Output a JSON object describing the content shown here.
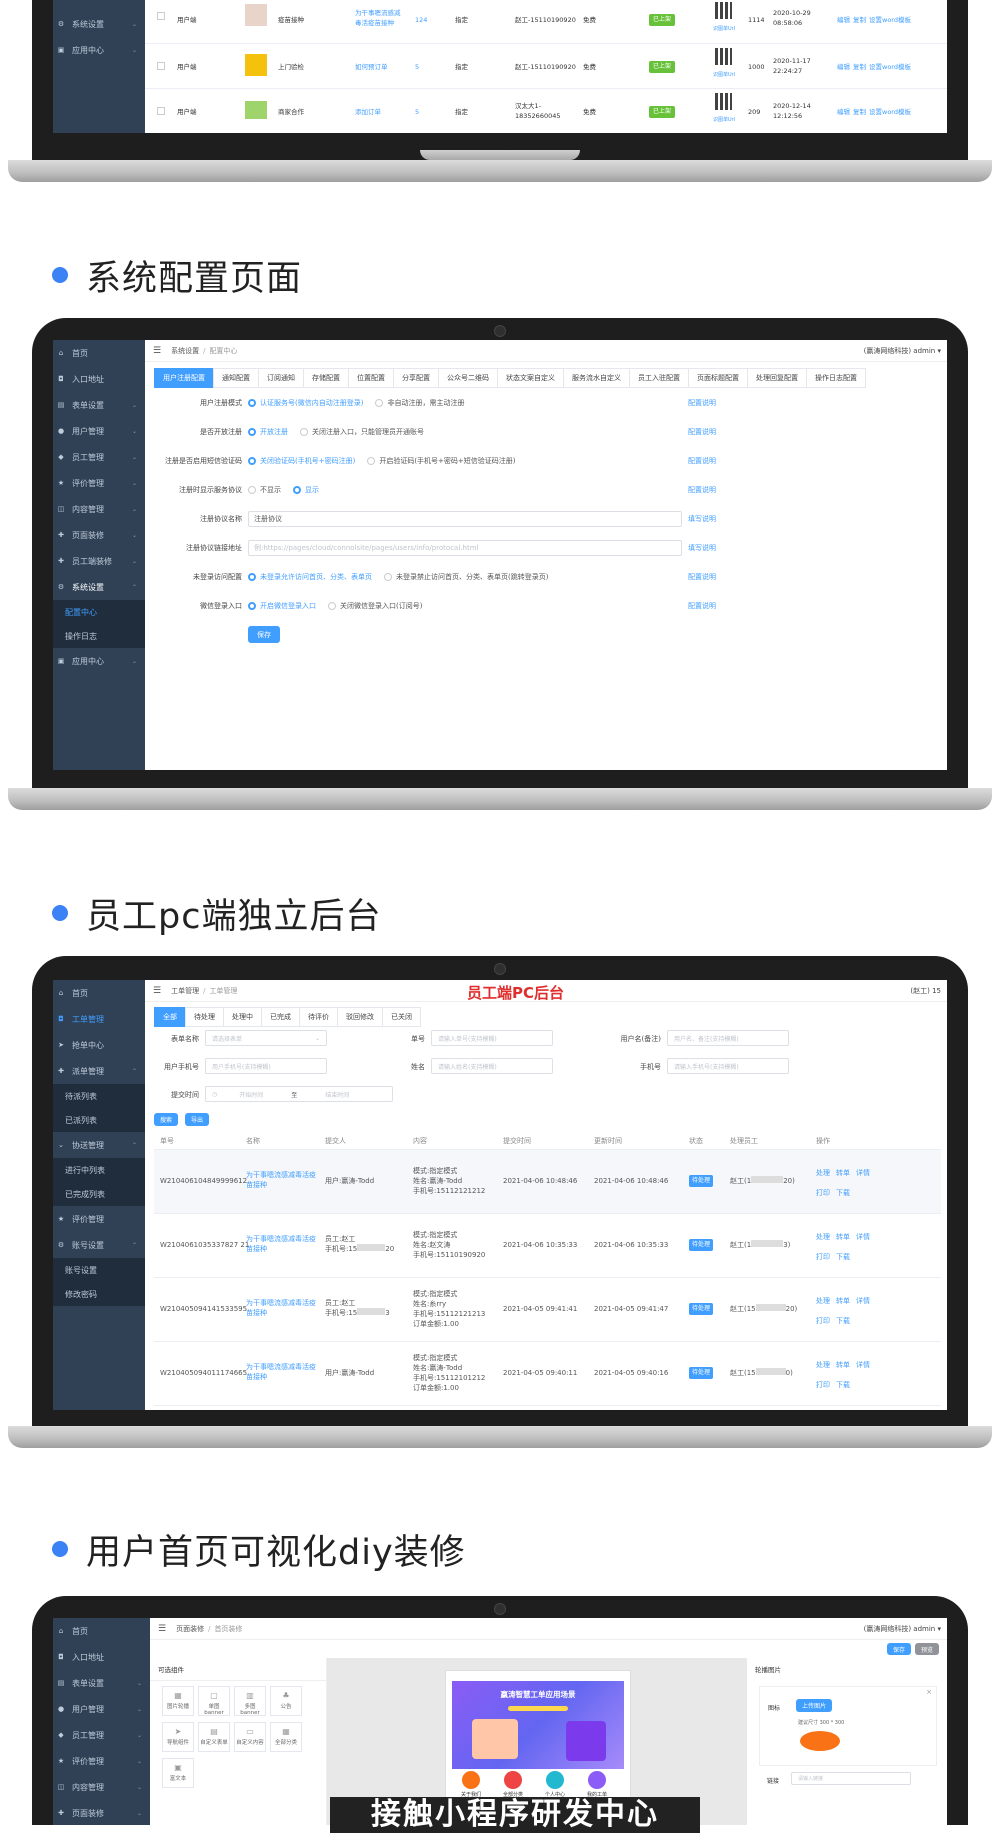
{
  "headings": {
    "sys_config": "系统配置页面",
    "staff_pc": "员工pc端独立后台",
    "user_diy": "用户首页可视化diy装修"
  },
  "colors": {
    "accent": "#409eff",
    "sidebar": "#304156",
    "dot": "#3b82f6",
    "overlay_red": "#e02d2d"
  },
  "screen1": {
    "sidebar": [
      {
        "label": "系统设置",
        "icon": "gear-icon"
      },
      {
        "label": "应用中心",
        "icon": "app-icon"
      }
    ],
    "rows": [
      {
        "c1": "用户端",
        "name": "疫苗接种",
        "link": "为干事嗯流感减毒活疫苗接种",
        "num": "124",
        "type": "指定",
        "staff": "赵工-15110190920",
        "fee": "免费",
        "status": "已上架",
        "qrlink": "识图单Url",
        "id": "1114",
        "time": "2020-10-29 08:58:06",
        "ops": [
          "编辑",
          "复制",
          "设置word模板"
        ]
      },
      {
        "c1": "用户端",
        "name": "上门验检",
        "link": "如何预订单",
        "num": "5",
        "type": "指定",
        "staff": "赵工-15110190920",
        "fee": "免费",
        "status": "已上架",
        "qrlink": "识图单Url",
        "id": "1000",
        "time": "2020-11-17 22:24:27",
        "ops": [
          "编辑",
          "复制",
          "设置word模板"
        ]
      },
      {
        "c1": "用户端",
        "name": "商家合作",
        "link": "添加订单",
        "num": "5",
        "type": "指定",
        "staff": "汉太大1-18352660045",
        "fee": "免费",
        "status": "已上架",
        "qrlink": "识图单Url",
        "id": "209",
        "time": "2020-12-14 12:12:56",
        "ops": [
          "编辑",
          "复制",
          "设置word模板"
        ]
      }
    ]
  },
  "screen2": {
    "sidebar": [
      {
        "label": "首页",
        "icon": "home-icon"
      },
      {
        "label": "入口地址",
        "icon": "entry-icon"
      },
      {
        "label": "表单设置",
        "icon": "form-icon"
      },
      {
        "label": "用户管理",
        "icon": "user-icon"
      },
      {
        "label": "员工管理",
        "icon": "staff-icon"
      },
      {
        "label": "评价管理",
        "icon": "star-icon"
      },
      {
        "label": "内容管理",
        "icon": "content-icon"
      },
      {
        "label": "页面装修",
        "icon": "plus-icon"
      },
      {
        "label": "员工端装修",
        "icon": "plus-icon"
      },
      {
        "label": "系统设置",
        "icon": "gear-icon"
      }
    ],
    "sidebar_sub": [
      "配置中心",
      "操作日志"
    ],
    "sidebar_last": {
      "label": "应用中心",
      "icon": "app-icon"
    },
    "breadcrumb": [
      "系统设置",
      "配置中心"
    ],
    "user": "(赢涛网络科技) admin",
    "tabs": [
      "用户注册配置",
      "通知配置",
      "订阅通知",
      "存储配置",
      "位置配置",
      "分享配置",
      "公众号二维码",
      "状态文案自定义",
      "服务流水自定义",
      "员工入驻配置",
      "页面标题配置",
      "处理回复配置",
      "操作日志配置"
    ],
    "rows": [
      {
        "label": "用户注册模式",
        "opts": [
          "认证服务号(微信内自动注册登录)",
          "非自动注册，需主动注册"
        ],
        "sel": 0,
        "help": "配置说明"
      },
      {
        "label": "是否开放注册",
        "opts": [
          "开放注册",
          "关闭注册入口，只能管理员开通账号"
        ],
        "sel": 0,
        "help": "配置说明"
      },
      {
        "label": "注册是否启用短信验证码",
        "opts": [
          "关闭验证码(手机号+密码注册)",
          "开启验证码(手机号+密码+短信验证码注册)"
        ],
        "sel": 0,
        "help": "配置说明"
      },
      {
        "label": "注册时显示服务协议",
        "opts": [
          "不显示",
          "显示"
        ],
        "sel": 1,
        "help": "配置说明"
      },
      {
        "label": "注册协议名称",
        "input": "注册协议",
        "help": "填写说明"
      },
      {
        "label": "注册协议链接地址",
        "input": "例:https://pages/cloud/connolsite/pages/users/info/protocal.html",
        "help": "填写说明"
      },
      {
        "label": "未登录访问配置",
        "opts": [
          "未登录允许访问首页、分类、表单页",
          "未登录禁止访问首页、分类、表单页(跳转登录页)"
        ],
        "sel": 0,
        "help": "配置说明"
      },
      {
        "label": "微信登录入口",
        "opts": [
          "开启微信登录入口",
          "关闭微信登录入口(订阅号)"
        ],
        "sel": 0,
        "help": "配置说明"
      }
    ],
    "save": "保存"
  },
  "screen3": {
    "overlay": "员工端PC后台",
    "sidebar": [
      {
        "label": "首页",
        "icon": "home-icon"
      },
      {
        "label": "工单管理",
        "icon": "ticket-icon",
        "active": true
      },
      {
        "label": "抢单中心",
        "icon": "send-icon"
      },
      {
        "label": "派单管理",
        "icon": "plus-icon"
      }
    ],
    "sub1": [
      "待派列表",
      "已派列表"
    ],
    "sidebar2": {
      "label": "协送管理",
      "icon": "chevron-icon"
    },
    "sub2": [
      "进行中列表",
      "已完成列表"
    ],
    "sidebar3": [
      {
        "label": "评价管理",
        "icon": "star-icon"
      },
      {
        "label": "账号设置",
        "icon": "gear-icon"
      }
    ],
    "sub3": [
      "账号设置",
      "修改密码"
    ],
    "breadcrumb": [
      "工单管理",
      "工单管理"
    ],
    "user": "(赵工) 15",
    "tabs": [
      "全部",
      "待处理",
      "处理中",
      "已完成",
      "待评价",
      "驳回修改",
      "已关闭"
    ],
    "filters": {
      "form_name": {
        "label": "表单名称",
        "ph": "请选择表单"
      },
      "order_no": {
        "label": "单号",
        "ph": "请输入单号(支持模糊)"
      },
      "remark": {
        "label": "用户名(备注)",
        "ph": "用户名、备注(支持模糊)"
      },
      "user_phone": {
        "label": "用户手机号",
        "ph": "用户手机号(支持模糊)"
      },
      "name": {
        "label": "姓名",
        "ph": "请输入姓名(支持模糊)"
      },
      "phone": {
        "label": "手机号",
        "ph": "请输入手机号(支持模糊)"
      },
      "time": {
        "label": "提交时间",
        "start": "开始时间",
        "to": "至",
        "end": "结束时间"
      }
    },
    "btn_search": "搜索",
    "btn_export": "导出",
    "columns": [
      "单号",
      "名称",
      "提交人",
      "内容",
      "提交时间",
      "更新时间",
      "状态",
      "处理员工",
      "操作"
    ],
    "rows": [
      {
        "no": "W210406104849999612",
        "name": "为干事嗯流感减毒活疫苗接种",
        "sub": "用户:赢涛-Todd",
        "content": [
          "模式:指定模式",
          "姓名:赢涛-Todd",
          "手机号:15112121212"
        ],
        "t1": "2021-04-06 10:48:46",
        "t2": "2021-04-06 10:48:46",
        "status": "待处理",
        "staff": "赵工(1",
        "staff_end": "20)",
        "ops": [
          "处理",
          "转单",
          "详情",
          "打印",
          "下载"
        ]
      },
      {
        "no": "W2104061035337827 21",
        "name": "为干事嗯流感减毒活疫苗接种",
        "sub": "员工:赵工",
        "sub2": "手机号:15",
        "sub2_end": "20",
        "content": [
          "模式:指定模式",
          "姓名:赵文涛",
          "手机号:15110190920"
        ],
        "t1": "2021-04-06 10:35:33",
        "t2": "2021-04-06 10:35:33",
        "status": "待处理",
        "staff": "赵工(1",
        "staff_end": "3)",
        "ops": [
          "处理",
          "转单",
          "详情",
          "打印",
          "下载"
        ]
      },
      {
        "no": "W210405094141533595",
        "name": "为干事嗯流感减毒活疫苗接种",
        "sub": "员工:赵工",
        "sub2": "手机号:15",
        "sub2_end": "3",
        "content": [
          "模式:指定模式",
          "姓名:糸rry",
          "手机号:15112121213",
          "订单金额:1.00"
        ],
        "t1": "2021-04-05 09:41:41",
        "t2": "2021-04-05 09:41:47",
        "status": "待处理",
        "staff": "赵工(15",
        "staff_end": "20)",
        "ops": [
          "处理",
          "转单",
          "详情",
          "打印",
          "下载"
        ]
      },
      {
        "no": "W210405094011174665",
        "name": "为干事嗯流感减毒活疫苗接种",
        "sub": "用户:赢涛-Todd",
        "content": [
          "模式:指定模式",
          "姓名:赢涛-Todd",
          "手机号:15112101212",
          "订单金额:1.00"
        ],
        "t1": "2021-04-05 09:40:11",
        "t2": "2021-04-05 09:40:16",
        "status": "待处理",
        "staff": "赵工(15",
        "staff_end": "0)",
        "ops": [
          "处理",
          "转单",
          "详情",
          "打印",
          "下载"
        ]
      }
    ]
  },
  "screen4": {
    "sidebar": [
      {
        "label": "首页",
        "icon": "home-icon"
      },
      {
        "label": "入口地址",
        "icon": "entry-icon"
      },
      {
        "label": "表单设置",
        "icon": "form-icon"
      },
      {
        "label": "用户管理",
        "icon": "user-icon"
      },
      {
        "label": "员工管理",
        "icon": "staff-icon"
      },
      {
        "label": "评价管理",
        "icon": "star-icon"
      },
      {
        "label": "内容管理",
        "icon": "content-icon"
      },
      {
        "label": "页面装修",
        "icon": "plus-icon"
      }
    ],
    "breadcrumb": [
      "页面装修",
      "首页装修"
    ],
    "user": "(赢涛网络科技) admin",
    "btn_save": "保存",
    "btn_preview": "预览",
    "left_title": "可选组件",
    "components": [
      "图片轮播",
      "单图banner",
      "多图banner",
      "公告",
      "导航组件",
      "自定义表单",
      "自定义内容",
      "全部分类",
      "富文本"
    ],
    "banner_title": "赢涛智慧工单应用场景",
    "phone_icons": [
      "关于我们",
      "全部分类",
      "个人中心",
      "我的工单"
    ],
    "right_title": "轮播图片",
    "right_icon_label": "图标",
    "upload": "上传图片",
    "size_hint": "建议尺寸 300 * 300",
    "link_label": "链接",
    "link_ph": "请输入链接"
  },
  "caption": "接触小程序研发中心"
}
